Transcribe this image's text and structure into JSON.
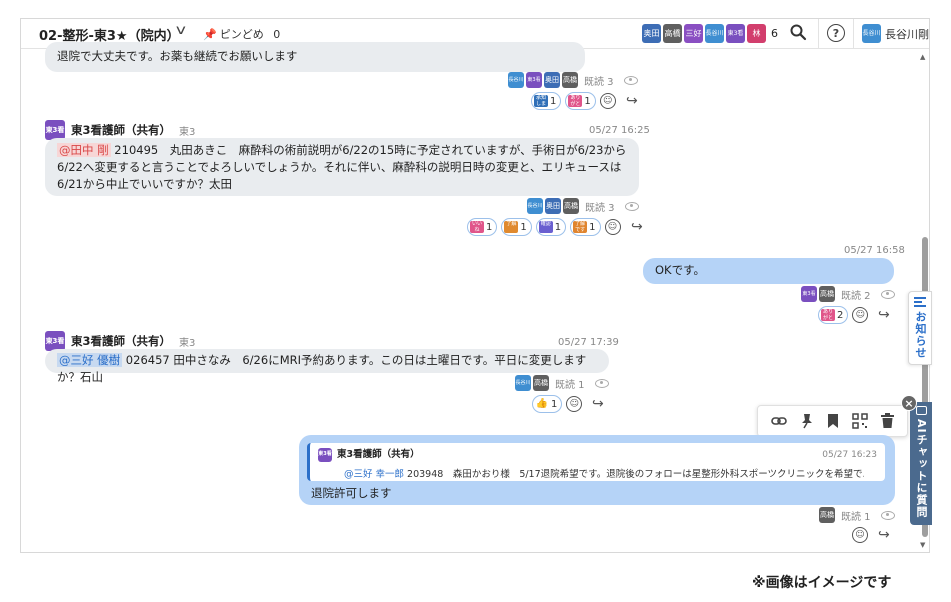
{
  "header": {
    "room_title": "02-整形-東3★（院内）",
    "pin_label": "ピンどめ",
    "pin_count": "0",
    "member_avatars": [
      {
        "label": "奥田",
        "color": "#3d6db5"
      },
      {
        "label": "高橋",
        "color": "#5f5f5f"
      },
      {
        "label": "三好",
        "color": "#8a4fc2"
      },
      {
        "label": "長谷川",
        "color": "#3f8ed1"
      },
      {
        "label": "東3看",
        "color": "#7a4fbf"
      },
      {
        "label": "林",
        "color": "#d23e6d"
      }
    ],
    "member_count": "6",
    "user_avatar": "長谷川",
    "user_name": "長谷川剛"
  },
  "messages": [
    {
      "text": "退院で大丈夫です。お薬も継続でお願いします",
      "read_avatars": [
        {
          "label": "長谷川",
          "color": "#3f8ed1"
        },
        {
          "label": "東3看",
          "color": "#7a4fbf"
        },
        {
          "label": "奥田",
          "color": "#3d6db5"
        },
        {
          "label": "高橋",
          "color": "#5f5f5f"
        }
      ],
      "read_label": "既読 3",
      "reactions": [
        {
          "sticker": "承知しました",
          "count": "1",
          "color": "#2f6fb8"
        },
        {
          "sticker": "ありがとう",
          "count": "1",
          "color": "#e0558a"
        }
      ]
    },
    {
      "sender": "東3看護師（共有）",
      "sender_avatar": "東3看",
      "ward": "東3",
      "time": "05/27 16:25",
      "mention": "@田中 剛",
      "text": " 210495　丸田あきこ　麻酔科の術前説明が6/22の15時に予定されていますが、手術日が6/23から6/22へ変更すると言うことでよろしいでしょうか。それに伴い、麻酔科の説明日時の変更と、エリキュースは6/21から中止でいいですか？太田",
      "read_avatars": [
        {
          "label": "長谷川",
          "color": "#3f8ed1"
        },
        {
          "label": "奥田",
          "color": "#3d6db5"
        },
        {
          "label": "高橋",
          "color": "#5f5f5f"
        }
      ],
      "read_label": "既読 3",
      "reactions": [
        {
          "sticker": "いいね",
          "count": "1",
          "color": "#e0558a"
        },
        {
          "sticker": "了解",
          "count": "1",
          "color": "#e08a2f"
        },
        {
          "sticker": "確認",
          "count": "1",
          "color": "#6a5fd0"
        },
        {
          "sticker": "了解です",
          "count": "1",
          "color": "#e0852f"
        }
      ]
    },
    {
      "time": "05/27 16:58",
      "text": "OKです。",
      "read_avatars": [
        {
          "label": "東3看",
          "color": "#7a4fbf"
        },
        {
          "label": "高橋",
          "color": "#5f5f5f"
        }
      ],
      "read_label": "既読 2",
      "reactions": [
        {
          "sticker": "ありがとう",
          "count": "2",
          "color": "#e0558a"
        }
      ]
    },
    {
      "sender": "東3看護師（共有）",
      "sender_avatar": "東3看",
      "ward": "東3",
      "time": "05/27 17:39",
      "mention": "@三好 優樹",
      "text": " 026457 田中さなみ　6/26にMRI予約あります。この日は土曜日です。平日に変更しますか？石山",
      "read_avatars": [
        {
          "label": "長谷川",
          "color": "#3f8ed1"
        },
        {
          "label": "高橋",
          "color": "#5f5f5f"
        }
      ],
      "read_label": "既読 1",
      "reactions": [
        {
          "sticker": "👍",
          "count": "1",
          "color": "#f0a030"
        }
      ]
    },
    {
      "quote": {
        "sender": "東3看護師（共有）",
        "sender_avatar": "東3看",
        "time": "05/27 16:23",
        "mention": "@三好 幸一郎",
        "text": " 203948　森田かおり様　5/17退院希望です。退院後のフォローは星整形外科スポーツクリニックを希望で…"
      },
      "text": "退院許可します",
      "read_avatars": [
        {
          "label": "高橋",
          "color": "#5f5f5f"
        }
      ],
      "read_label": "既読 1"
    }
  ],
  "toolbar": {
    "icons": [
      "link-icon",
      "pin-icon",
      "bookmark-icon",
      "qr-code-icon",
      "trash-icon"
    ]
  },
  "side": {
    "news_label": "お知らせ",
    "ai_label": "AIチャットに質問"
  },
  "caption": "※画像はイメージです"
}
